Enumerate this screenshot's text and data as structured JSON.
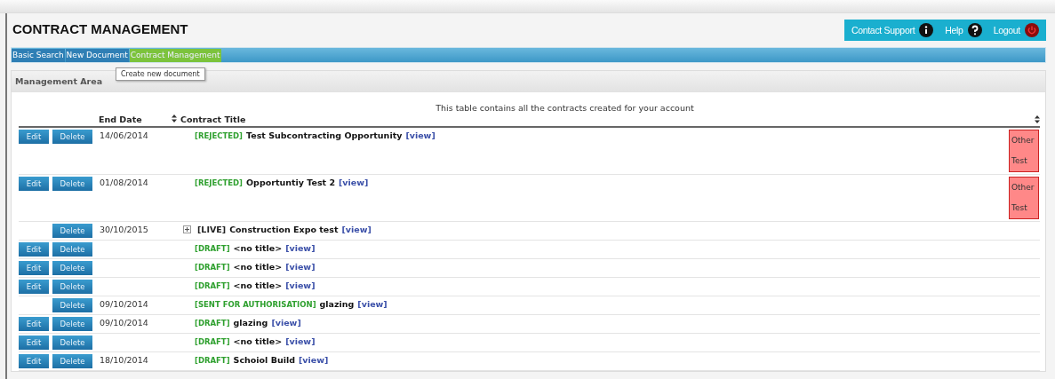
{
  "header": {
    "title": "CONTRACT MANAGEMENT",
    "links": [
      {
        "label": "Contact Support",
        "kind": "info"
      },
      {
        "label": "Help",
        "kind": "help"
      },
      {
        "label": "Logout",
        "kind": "power"
      }
    ]
  },
  "nav": [
    {
      "label": "Basic Search",
      "selected": false
    },
    {
      "label": "New Document",
      "selected": false
    },
    {
      "label": "Contract Management",
      "selected": true
    }
  ],
  "tooltip": "Create new document",
  "panel": {
    "title": "Management Area"
  },
  "table": {
    "caption": "This table contains all the contracts created for your account",
    "columns": [
      {
        "label": "End Date",
        "sortable": false
      },
      {
        "label": "Contract Title",
        "sortable": true
      }
    ],
    "rows": [
      {
        "edit": "Edit",
        "delete": "Delete",
        "end_date": "14/06/2014",
        "kind": "status",
        "status": "[REJECTED]",
        "title": "Test Subcontracting Opportunity",
        "link": "[view]",
        "tag": "Other Test"
      },
      {
        "edit": "Edit",
        "delete": "Delete",
        "end_date": "01/08/2014",
        "kind": "status",
        "status": "[REJECTED]",
        "title": "Opportuntiy Test 2",
        "link": "[view]",
        "tag": "Other Test"
      },
      {
        "delete": "Delete",
        "end_date": "30/10/2015",
        "kind": "live",
        "status": "[LIVE]",
        "title": "Construction Expo test",
        "link": "[view]"
      },
      {
        "edit": "Edit",
        "delete": "Delete",
        "kind": "status",
        "status": "[DRAFT]",
        "title": "<no title>",
        "link": "[view]"
      },
      {
        "edit": "Edit",
        "delete": "Delete",
        "kind": "status",
        "status": "[DRAFT]",
        "title": "<no title>",
        "link": "[view]"
      },
      {
        "edit": "Edit",
        "delete": "Delete",
        "kind": "status",
        "status": "[DRAFT]",
        "title": "<no title>",
        "link": "[view]"
      },
      {
        "delete": "Delete",
        "end_date": "09/10/2014",
        "kind": "status",
        "status": "[SENT FOR AUTHORISATION]",
        "title": "glazing",
        "link": "[view]"
      },
      {
        "edit": "Edit",
        "delete": "Delete",
        "end_date": "09/10/2014",
        "kind": "status",
        "status": "[DRAFT]",
        "title": "glazing",
        "link": "[view]"
      },
      {
        "edit": "Edit",
        "delete": "Delete",
        "kind": "status",
        "status": "[DRAFT]",
        "title": "<no title>",
        "link": "[view]"
      },
      {
        "edit": "Edit",
        "delete": "Delete",
        "end_date": "18/10/2014",
        "kind": "status",
        "status": "[DRAFT]",
        "title": "Schoiol Build",
        "link": "[view]"
      }
    ]
  }
}
